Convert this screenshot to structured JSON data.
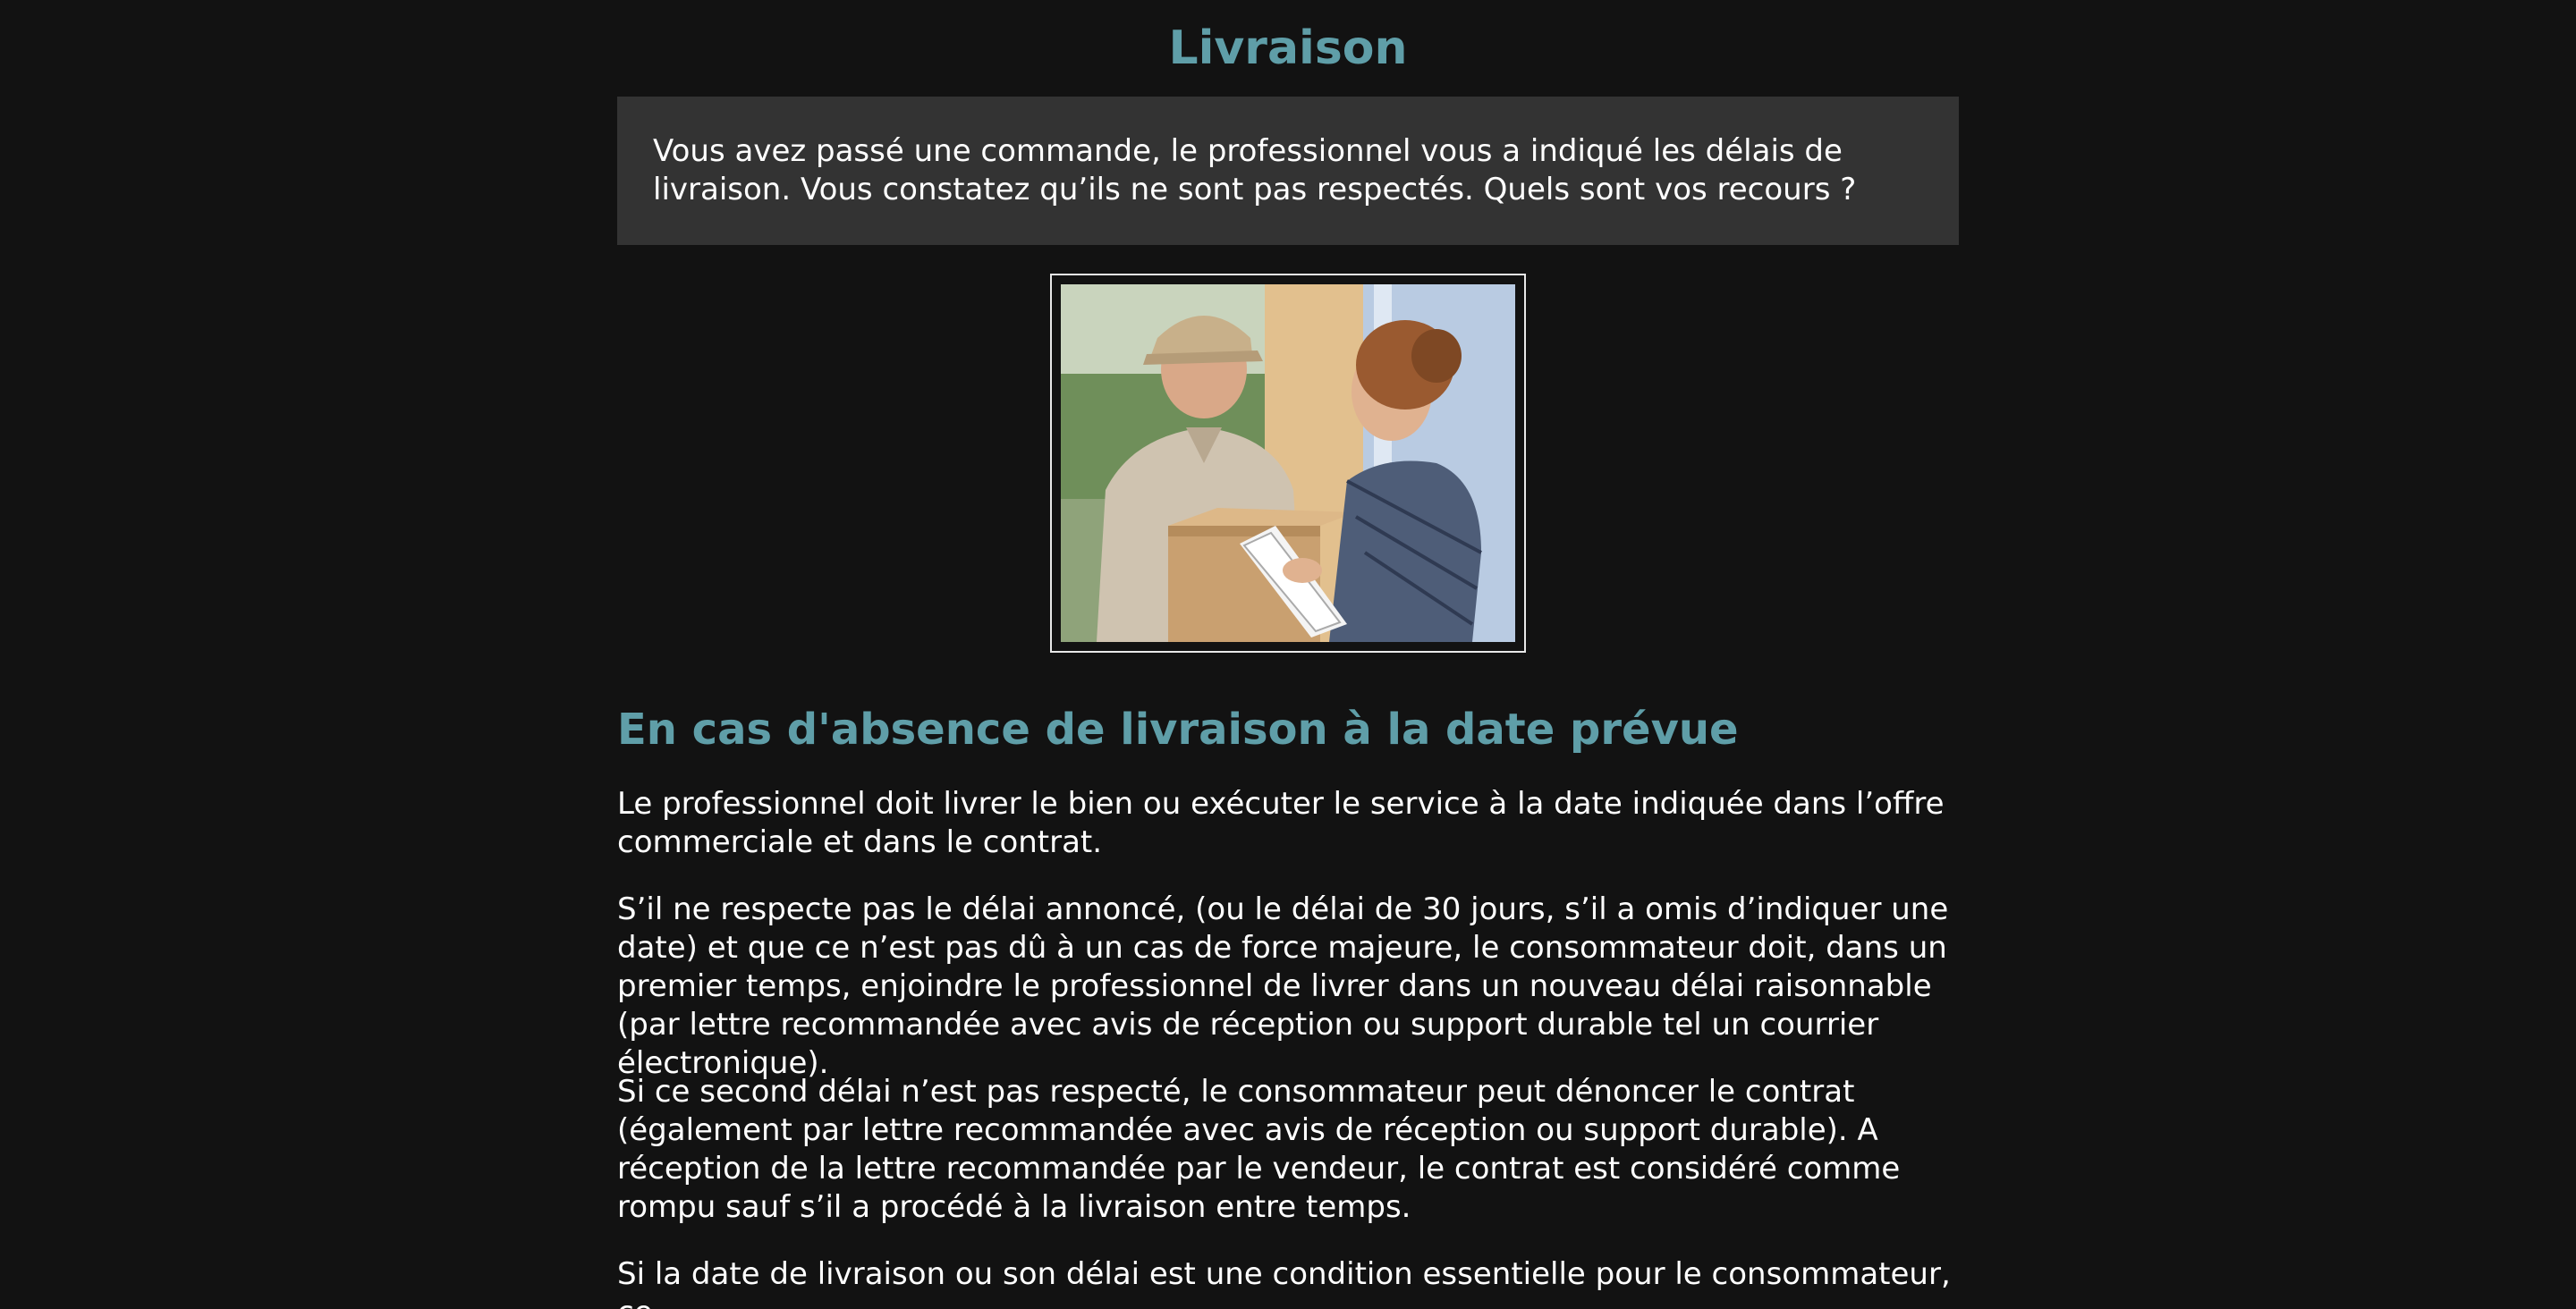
{
  "page": {
    "title": "Livraison",
    "intro": "Vous avez passé une commande, le professionnel vous a indiqué les délais de livraison. Vous constatez qu’ils ne sont pas respectés. Quels sont vos recours ?",
    "section_heading": "En cas d'absence de livraison à la date prévue",
    "paragraphs": [
      "Le professionnel doit livrer le bien ou exécuter le service à la date indiquée dans l’offre commerciale et dans le contrat.",
      "S’il ne respecte pas le délai annoncé, (ou le délai de 30 jours, s’il a omis d’indiquer une date) et que ce n’est pas dû à un cas de force majeure, le consommateur doit, dans un premier temps, enjoindre le professionnel de livrer dans un nouveau délai raisonnable (par lettre recommandée avec avis de réception ou support durable tel un courrier électronique).",
      "Si ce second délai n’est pas respecté, le consommateur peut dénoncer le contrat (également par lettre recommandée avec avis de réception ou support durable). A réception de la lettre recommandée par le vendeur, le contrat est considéré comme rompu sauf s’il a procédé à la livraison entre temps.",
      "Si la date de livraison ou son délai est une condition essentielle pour le consommateur, ce"
    ]
  },
  "colors": {
    "background": "#121212",
    "heading": "#5f9ea8",
    "intro_box": "#333333",
    "text": "#ffffff"
  }
}
